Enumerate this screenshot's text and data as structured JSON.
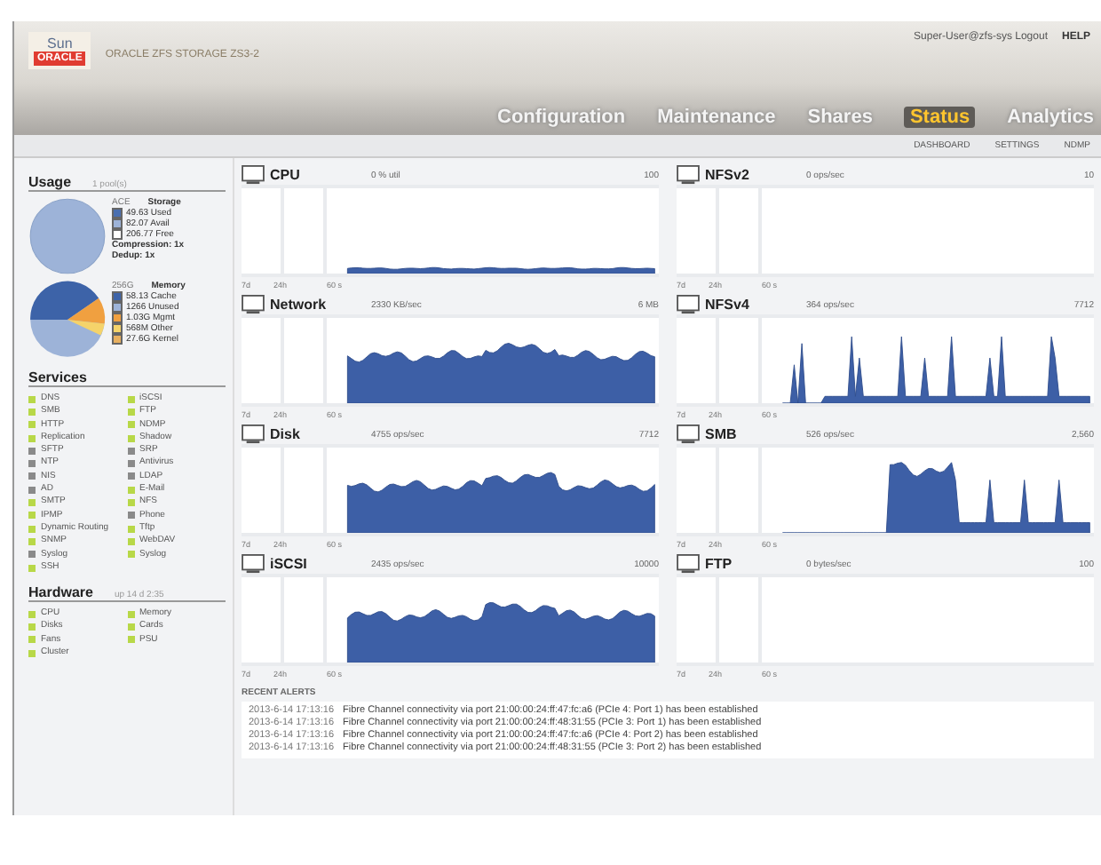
{
  "header": {
    "logo_top": "Sun",
    "logo_bottom": "ORACLE",
    "product": "ORACLE ZFS STORAGE ZS3-2",
    "user": "Super-User@zfs-sys Logout",
    "help": "HELP"
  },
  "tabs": [
    {
      "label": "Configuration",
      "selected": false
    },
    {
      "label": "Maintenance",
      "selected": false
    },
    {
      "label": "Shares",
      "selected": false
    },
    {
      "label": "Status",
      "selected": true
    },
    {
      "label": "Analytics",
      "selected": false
    }
  ],
  "subtabs": [
    "DASHBOARD",
    "SETTINGS",
    "NDMP"
  ],
  "usage": {
    "title": "Usage",
    "note": "1 pool(s)",
    "storage": {
      "size": "ACE",
      "label": "Storage",
      "legend": [
        {
          "text": "49.63 Used",
          "color": "#4a6fb0"
        },
        {
          "text": "82.07 Avail",
          "color": "#9db3d8"
        },
        {
          "text": "206.77 Free",
          "color": "#ffffff"
        }
      ],
      "compression": "Compression: 1x",
      "dedup": "Dedup: 1x"
    },
    "memory": {
      "size": "256G",
      "label": "Memory",
      "legend": [
        {
          "text": "58.13 Cache",
          "color": "#3d63a8"
        },
        {
          "text": "1266 Unused",
          "color": "#9db3d8"
        },
        {
          "text": "1.03G Mgmt",
          "color": "#f0a040"
        },
        {
          "text": "568M Other",
          "color": "#f5d36a"
        },
        {
          "text": "27.6G Kernel",
          "color": "#e8b060"
        }
      ]
    }
  },
  "services": {
    "title": "Services",
    "columns": [
      [
        {
          "name": "DNS",
          "color": "#b8d848"
        },
        {
          "name": "SMB",
          "color": "#b8d848"
        },
        {
          "name": "HTTP",
          "color": "#b8d848"
        },
        {
          "name": "Replication",
          "color": "#b8d848"
        },
        {
          "name": "SFTP",
          "color": "#8a8a8a"
        },
        {
          "name": "NTP",
          "color": "#8a8a8a"
        },
        {
          "name": "NIS",
          "color": "#8a8a8a"
        },
        {
          "name": "AD",
          "color": "#8a8a8a"
        },
        {
          "name": "SMTP",
          "color": "#b8d848"
        },
        {
          "name": "IPMP",
          "color": "#b8d848"
        },
        {
          "name": "Dynamic Routing",
          "color": "#b8d848"
        },
        {
          "name": "SNMP",
          "color": "#b8d848"
        },
        {
          "name": "Syslog",
          "color": "#8a8a8a"
        },
        {
          "name": "SSH",
          "color": "#b8d848"
        }
      ],
      [
        {
          "name": "iSCSI",
          "color": "#b8d848"
        },
        {
          "name": "FTP",
          "color": "#b8d848"
        },
        {
          "name": "NDMP",
          "color": "#b8d848"
        },
        {
          "name": "Shadow",
          "color": "#b8d848"
        },
        {
          "name": "SRP",
          "color": "#8a8a8a"
        },
        {
          "name": "Antivirus",
          "color": "#8a8a8a"
        },
        {
          "name": "LDAP",
          "color": "#8a8a8a"
        },
        {
          "name": "E-Mail",
          "color": "#b8d848"
        },
        {
          "name": "NFS",
          "color": "#b8d848"
        },
        {
          "name": "Phone",
          "color": "#8a8a8a"
        },
        {
          "name": "Tftp",
          "color": "#b8d848"
        },
        {
          "name": "WebDAV",
          "color": "#b8d848"
        },
        {
          "name": "Syslog",
          "color": "#b8d848"
        }
      ]
    ]
  },
  "hardware": {
    "title": "Hardware",
    "note": "up 14 d 2:35",
    "columns": [
      [
        {
          "name": "CPU",
          "color": "#b8d848"
        },
        {
          "name": "Disks",
          "color": "#b8d848"
        },
        {
          "name": "Fans",
          "color": "#b8d848"
        },
        {
          "name": "Cluster",
          "color": "#b8d848"
        }
      ],
      [
        {
          "name": "Memory",
          "color": "#b8d848"
        },
        {
          "name": "Cards",
          "color": "#b8d848"
        },
        {
          "name": "PSU",
          "color": "#b8d848"
        }
      ]
    ]
  },
  "panels": [
    {
      "title": "CPU",
      "stat": "0 % util",
      "max": "100",
      "kind": "line",
      "ranges": [
        "7d",
        "24h",
        "60 s"
      ]
    },
    {
      "title": "NFSv2",
      "stat": "0 ops/sec",
      "max": "10",
      "kind": "empty",
      "ranges": [
        "7d",
        "24h",
        "60 s"
      ]
    },
    {
      "title": "Network",
      "stat": "2330 KB/sec",
      "max": "6 MB",
      "kind": "block",
      "ranges": [
        "7d",
        "24h",
        "60 s"
      ]
    },
    {
      "title": "NFSv4",
      "stat": "364 ops/sec",
      "max": "7712",
      "kind": "spikes",
      "ranges": [
        "7d",
        "24h",
        "60 s"
      ]
    },
    {
      "title": "Disk",
      "stat": "4755 ops/sec",
      "max": "7712",
      "kind": "block",
      "ranges": [
        "7d",
        "24h",
        "60 s"
      ]
    },
    {
      "title": "SMB",
      "stat": "526 ops/sec",
      "max": "2,560",
      "kind": "bursts",
      "ranges": [
        "7d",
        "24h",
        "60 s"
      ]
    },
    {
      "title": "iSCSI",
      "stat": "2435 ops/sec",
      "max": "10000",
      "kind": "block",
      "ranges": [
        "7d",
        "24h",
        "60 s"
      ]
    },
    {
      "title": "FTP",
      "stat": "0 bytes/sec",
      "max": "100",
      "kind": "empty",
      "ranges": [
        "7d",
        "24h",
        "60 s"
      ]
    }
  ],
  "alerts": {
    "title": "RECENT ALERTS",
    "rows": [
      {
        "time": "2013-6-14 17:13:16",
        "text": "Fibre Channel connectivity via port 21:00:00:24:ff:47:fc:a6 (PCIe 4: Port 1) has been established"
      },
      {
        "time": "2013-6-14 17:13:16",
        "text": "Fibre Channel connectivity via port 21:00:00:24:ff:48:31:55 (PCIe 3: Port 1) has been established"
      },
      {
        "time": "2013-6-14 17:13:16",
        "text": "Fibre Channel connectivity via port 21:00:00:24:ff:47:fc:a6 (PCIe 4: Port 2) has been established"
      },
      {
        "time": "2013-6-14 17:13:16",
        "text": "Fibre Channel connectivity via port 21:00:00:24:ff:48:31:55 (PCIe 3: Port 2) has been established"
      }
    ]
  }
}
